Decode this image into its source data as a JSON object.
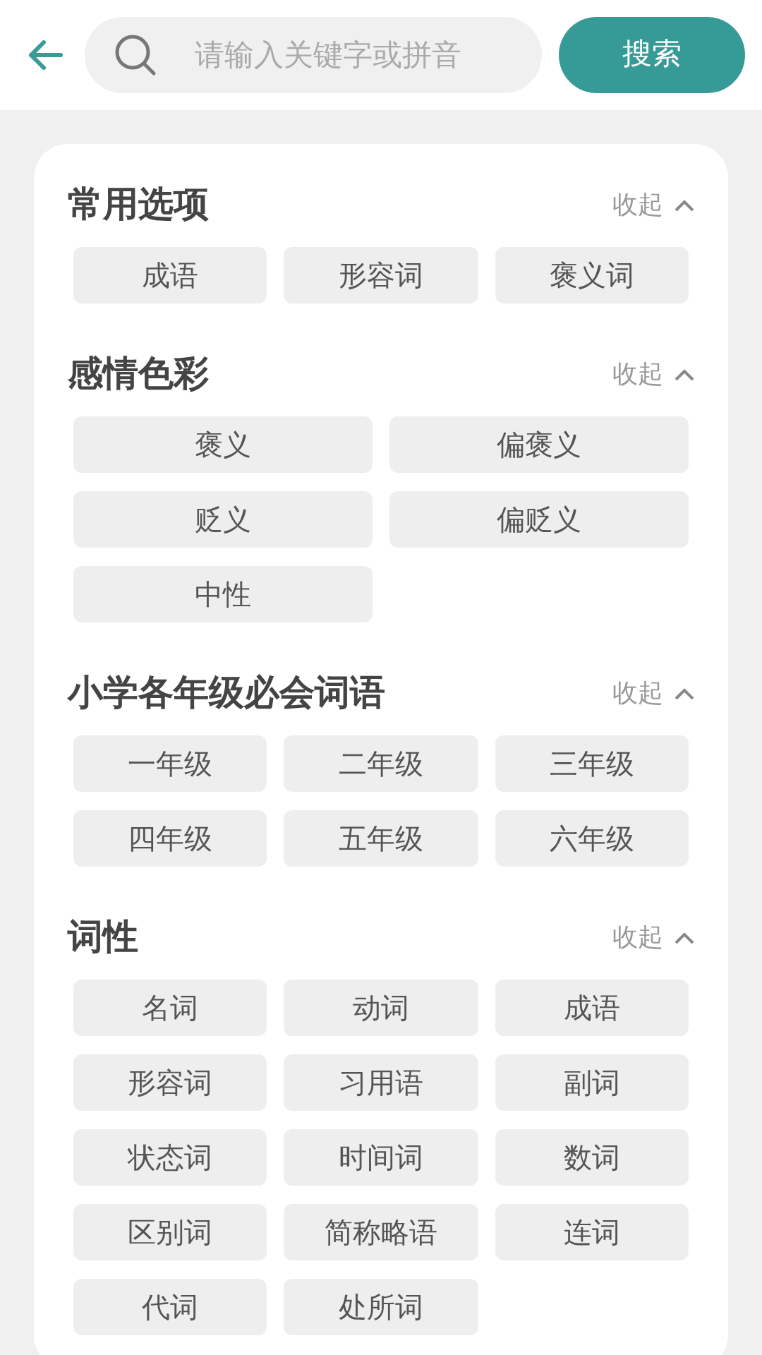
{
  "search": {
    "placeholder": "请输入关键字或拼音",
    "button": "搜索"
  },
  "sections": [
    {
      "title": "常用选项",
      "toggle": "收起",
      "expanded": true,
      "kind": "three-column",
      "options": [
        "成语",
        "形容词",
        "褒义词"
      ]
    },
    {
      "title": "感情色彩",
      "toggle": "收起",
      "expanded": true,
      "kind": "two-column",
      "options": [
        "褒义",
        "偏褒义",
        "贬义",
        "偏贬义",
        "中性"
      ]
    },
    {
      "title": "小学各年级必会词语",
      "toggle": "收起",
      "expanded": true,
      "kind": "three-column",
      "options": [
        "一年级",
        "二年级",
        "三年级",
        "四年级",
        "五年级",
        "六年级"
      ]
    },
    {
      "title": "词性",
      "toggle": "收起",
      "expanded": true,
      "kind": "three-column",
      "options": [
        "名词",
        "动词",
        "成语",
        "形容词",
        "习用语",
        "副词",
        "状态词",
        "时间词",
        "数词",
        "区别词",
        "简称略语",
        "连词",
        "代词",
        "处所词"
      ]
    }
  ]
}
